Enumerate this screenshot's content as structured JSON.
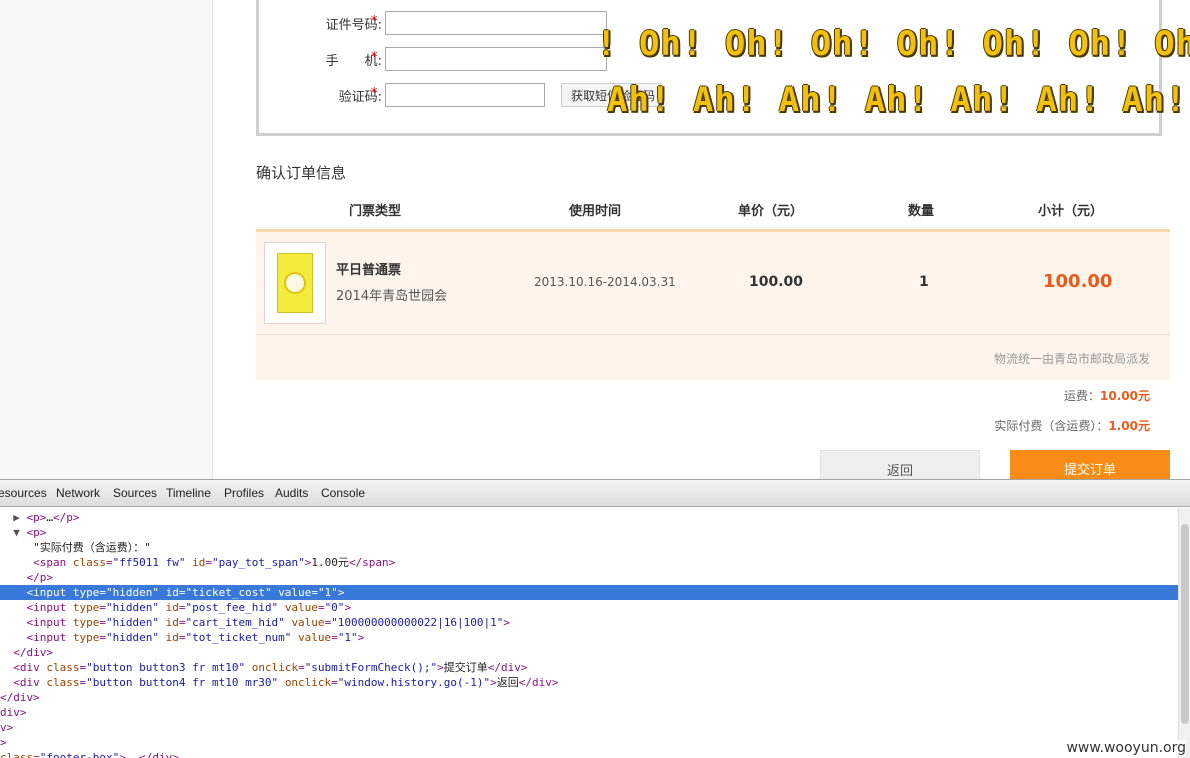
{
  "form": {
    "id_label": "证件号码:",
    "phone_label": "手　　机:",
    "code_label": "验证码:",
    "required_mark": "*",
    "id_value": "",
    "phone_value": "",
    "code_value": "",
    "sms_button": "获取短信验证码"
  },
  "overlay": {
    "oh_text": "! Oh! Oh! Oh! Oh! Oh! Oh! Oh!",
    "ah_text": "Ah! Ah! Ah! Ah! Ah! Ah! Ah!",
    "color": "#f3c10b"
  },
  "order": {
    "section_title": "确认订单信息",
    "headers": {
      "type": "门票类型",
      "time": "使用时间",
      "price": "单价（元）",
      "qty": "数量",
      "subtotal": "小计（元）"
    },
    "item": {
      "name": "平日普通票",
      "event": "2014年青岛世园会",
      "date_range": "2013.10.16-2014.03.31",
      "price": "100.00",
      "qty": "1",
      "subtotal": "100.00"
    },
    "shipping_note": "物流统一由青岛市邮政局派发",
    "postage_label": "运费：",
    "postage_value": "10.00元",
    "total_label": "实际付费（含运费）：",
    "total_value": "1.00元",
    "back_button": "返回",
    "submit_button": "提交订单",
    "accent": "#f98c17"
  },
  "devtools": {
    "tabs": [
      "esources",
      "Network",
      "Sources",
      "Timeline",
      "Profiles",
      "Audits",
      "Console"
    ],
    "lines": [
      {
        "indent": "  ",
        "parts": [
          [
            "tri",
            "▶ "
          ],
          [
            "tag",
            "<p>"
          ],
          [
            "text",
            "…"
          ],
          [
            "tag",
            "</p>"
          ]
        ]
      },
      {
        "indent": "  ",
        "parts": [
          [
            "tri",
            "▼ "
          ],
          [
            "tag",
            "<p>"
          ]
        ]
      },
      {
        "indent": "     ",
        "parts": [
          [
            "text",
            "\"实际付费（含运费）：\""
          ]
        ]
      },
      {
        "indent": "     ",
        "parts": [
          [
            "tag",
            "<span "
          ],
          [
            "attr",
            "class"
          ],
          [
            "tag",
            "="
          ],
          [
            "val",
            "\"ff5011 fw\""
          ],
          [
            "tag",
            " "
          ],
          [
            "attr",
            "id"
          ],
          [
            "tag",
            "="
          ],
          [
            "val",
            "\"pay_tot_span\""
          ],
          [
            "tag",
            ">"
          ],
          [
            "text",
            "1.00元"
          ],
          [
            "tag",
            "</span>"
          ]
        ]
      },
      {
        "indent": "    ",
        "parts": [
          [
            "tag",
            "</p>"
          ]
        ]
      },
      {
        "indent": "    ",
        "parts": [
          [
            "tag",
            "<input "
          ],
          [
            "attr",
            "type"
          ],
          [
            "tag",
            "="
          ],
          [
            "val",
            "\"hidden\""
          ],
          [
            "tag",
            " "
          ],
          [
            "attr",
            "id"
          ],
          [
            "tag",
            "="
          ],
          [
            "val",
            "\"ticket_cost\""
          ],
          [
            "tag",
            " "
          ],
          [
            "attr",
            "value"
          ],
          [
            "tag",
            "="
          ],
          [
            "val",
            "\"1\""
          ],
          [
            "tag",
            ">"
          ]
        ]
      },
      {
        "indent": "    ",
        "parts": [
          [
            "tag",
            "<input "
          ],
          [
            "attr",
            "type"
          ],
          [
            "tag",
            "="
          ],
          [
            "val",
            "\"hidden\""
          ],
          [
            "tag",
            " "
          ],
          [
            "attr",
            "id"
          ],
          [
            "tag",
            "="
          ],
          [
            "val",
            "\"post_fee_hid\""
          ],
          [
            "tag",
            " "
          ],
          [
            "attr",
            "value"
          ],
          [
            "tag",
            "="
          ],
          [
            "val",
            "\"0\""
          ],
          [
            "tag",
            ">"
          ]
        ]
      },
      {
        "indent": "    ",
        "parts": [
          [
            "tag",
            "<input "
          ],
          [
            "attr",
            "type"
          ],
          [
            "tag",
            "="
          ],
          [
            "val",
            "\"hidden\""
          ],
          [
            "tag",
            " "
          ],
          [
            "attr",
            "id"
          ],
          [
            "tag",
            "="
          ],
          [
            "val",
            "\"cart_item_hid\""
          ],
          [
            "tag",
            " "
          ],
          [
            "attr",
            "value"
          ],
          [
            "tag",
            "="
          ],
          [
            "val",
            "\"100000000000022|16|100|1\""
          ],
          [
            "tag",
            ">"
          ]
        ]
      },
      {
        "indent": "    ",
        "parts": [
          [
            "tag",
            "<input "
          ],
          [
            "attr",
            "type"
          ],
          [
            "tag",
            "="
          ],
          [
            "val",
            "\"hidden\""
          ],
          [
            "tag",
            " "
          ],
          [
            "attr",
            "id"
          ],
          [
            "tag",
            "="
          ],
          [
            "val",
            "\"tot_ticket_num\""
          ],
          [
            "tag",
            " "
          ],
          [
            "attr",
            "value"
          ],
          [
            "tag",
            "="
          ],
          [
            "val",
            "\"1\""
          ],
          [
            "tag",
            ">"
          ]
        ]
      },
      {
        "indent": "  ",
        "parts": [
          [
            "tag",
            "</div>"
          ]
        ]
      },
      {
        "indent": "  ",
        "parts": [
          [
            "tag",
            "<div "
          ],
          [
            "attr",
            "class"
          ],
          [
            "tag",
            "="
          ],
          [
            "val",
            "\"button button3 fr mt10\""
          ],
          [
            "tag",
            " "
          ],
          [
            "attr",
            "onclick"
          ],
          [
            "tag",
            "="
          ],
          [
            "val",
            "\"submitFormCheck();\""
          ],
          [
            "tag",
            ">"
          ],
          [
            "text",
            "提交订单"
          ],
          [
            "tag",
            "</div>"
          ]
        ]
      },
      {
        "indent": "  ",
        "parts": [
          [
            "tag",
            "<div "
          ],
          [
            "attr",
            "class"
          ],
          [
            "tag",
            "="
          ],
          [
            "val",
            "\"button button4 fr mt10 mr30\""
          ],
          [
            "tag",
            " "
          ],
          [
            "attr",
            "onclick"
          ],
          [
            "tag",
            "="
          ],
          [
            "val",
            "\"window.history.go(-1)\""
          ],
          [
            "tag",
            ">"
          ],
          [
            "text",
            "返回"
          ],
          [
            "tag",
            "</div>"
          ]
        ]
      },
      {
        "indent": "",
        "parts": [
          [
            "tag",
            "</div>"
          ]
        ]
      },
      {
        "indent": "",
        "parts": [
          [
            "tag",
            "div>"
          ]
        ]
      },
      {
        "indent": "",
        "parts": [
          [
            "tag",
            "v>"
          ]
        ]
      },
      {
        "indent": "",
        "parts": [
          [
            "tag",
            ">"
          ]
        ]
      },
      {
        "indent": "",
        "parts": [
          [
            "attr",
            "class"
          ],
          [
            "tag",
            "="
          ],
          [
            "val",
            "\"footer-box\""
          ],
          [
            "tag",
            "> "
          ],
          [
            "text",
            "…"
          ],
          [
            "tag",
            "</div>"
          ]
        ]
      }
    ],
    "selected_line": 5
  },
  "watermark": "www.wooyun.org"
}
